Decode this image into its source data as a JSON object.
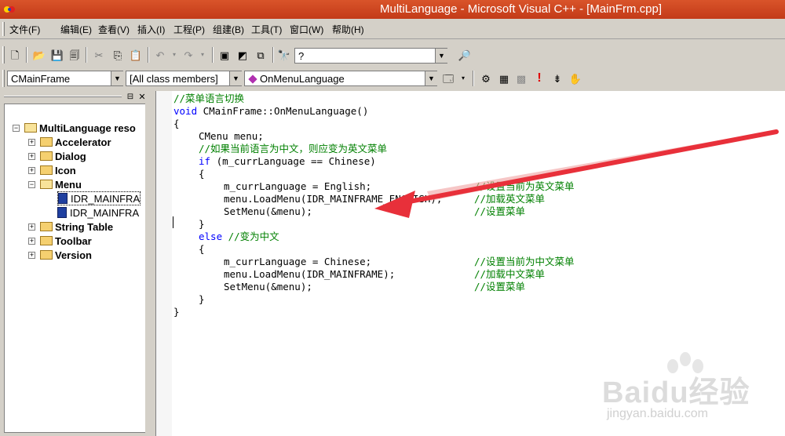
{
  "window": {
    "title": "MultiLanguage - Microsoft Visual C++ - [MainFrm.cpp]"
  },
  "menu": [
    "文件(F)",
    "编辑(E)",
    "查看(V)",
    "插入(I)",
    "工程(P)",
    "组建(B)",
    "工具(T)",
    "窗口(W)",
    "帮助(H)"
  ],
  "toolbar": {
    "find_value": "?"
  },
  "wizardbar": {
    "class_combo": "CMainFrame",
    "filter_combo": "[All class members]",
    "member_combo": "OnMenuLanguage"
  },
  "tree": {
    "root": "MultiLanguage reso",
    "items": [
      "Accelerator",
      "Dialog",
      "Icon",
      "Menu",
      "IDR_MAINFRA",
      "IDR_MAINFRA",
      "String Table",
      "Toolbar",
      "Version"
    ]
  },
  "code": [
    {
      "indent": 0,
      "parts": [
        {
          "t": "//菜单语言切换",
          "c": "cm"
        }
      ]
    },
    {
      "indent": 0,
      "parts": [
        {
          "t": "void",
          "c": "kw"
        },
        {
          "t": " CMainFrame::OnMenuLanguage()",
          "c": ""
        }
      ]
    },
    {
      "indent": 0,
      "parts": [
        {
          "t": "{",
          "c": ""
        }
      ]
    },
    {
      "indent": 1,
      "parts": [
        {
          "t": "CMenu menu;",
          "c": ""
        }
      ]
    },
    {
      "indent": 1,
      "parts": [
        {
          "t": "//如果当前语言为中文，则应变为英文菜单",
          "c": "cm"
        }
      ]
    },
    {
      "indent": 1,
      "parts": [
        {
          "t": "if",
          "c": "kw"
        },
        {
          "t": " (m_currLanguage == Chinese)",
          "c": ""
        }
      ]
    },
    {
      "indent": 1,
      "parts": [
        {
          "t": "{",
          "c": ""
        }
      ]
    },
    {
      "indent": 2,
      "parts": [
        {
          "t": "m_currLanguage = English;",
          "c": ""
        }
      ],
      "comment": "//设置当前为英文菜单"
    },
    {
      "indent": 2,
      "parts": [
        {
          "t": "menu.LoadMenu(IDR_MAINFRAME_ENGLISH);",
          "c": ""
        }
      ],
      "comment": "//加载英文菜单"
    },
    {
      "indent": 2,
      "parts": [
        {
          "t": "SetMenu(&menu);",
          "c": ""
        }
      ],
      "comment": "//设置菜单"
    },
    {
      "indent": 1,
      "parts": [
        {
          "t": "}",
          "c": ""
        }
      ]
    },
    {
      "indent": 1,
      "parts": [
        {
          "t": "else",
          "c": "kw"
        },
        {
          "t": " //变为中文",
          "c": "cm"
        }
      ]
    },
    {
      "indent": 1,
      "parts": [
        {
          "t": "{",
          "c": ""
        }
      ]
    },
    {
      "indent": 2,
      "parts": [
        {
          "t": "m_currLanguage = Chinese;",
          "c": ""
        }
      ],
      "comment": "//设置当前为中文菜单"
    },
    {
      "indent": 2,
      "parts": [
        {
          "t": "menu.LoadMenu(IDR_MAINFRAME);",
          "c": ""
        }
      ],
      "comment": "//加载中文菜单"
    },
    {
      "indent": 2,
      "parts": [
        {
          "t": "SetMenu(&menu);",
          "c": ""
        }
      ],
      "comment": "//设置菜单"
    },
    {
      "indent": 1,
      "parts": [
        {
          "t": "}",
          "c": ""
        }
      ]
    },
    {
      "indent": 0,
      "parts": [
        {
          "t": "}",
          "c": ""
        }
      ]
    }
  ],
  "watermark": {
    "brand": "Baidu经验",
    "url": "jingyan.baidu.com"
  },
  "colors": {
    "titlebar": "#c8401c",
    "keyword": "#0000ff",
    "comment": "#008000",
    "arrow": "#e8303a"
  }
}
